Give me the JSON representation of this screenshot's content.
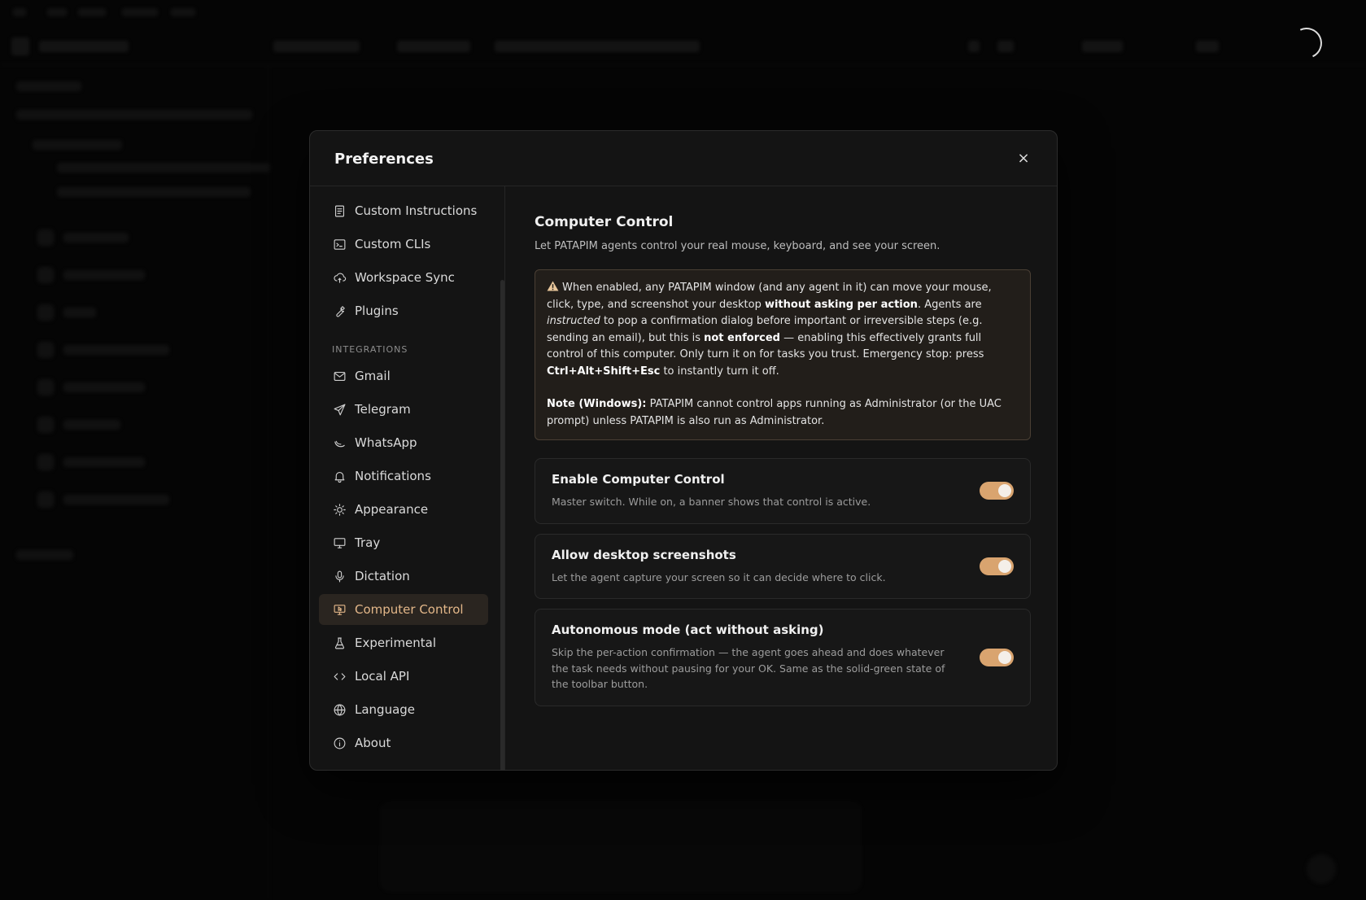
{
  "modal": {
    "title": "Preferences",
    "close_label": "×"
  },
  "nav": {
    "items_top": [
      {
        "label": "Custom Instructions",
        "icon": "document-icon"
      },
      {
        "label": "Custom CLIs",
        "icon": "terminal-icon"
      },
      {
        "label": "Workspace Sync",
        "icon": "cloud-sync-icon"
      },
      {
        "label": "Plugins",
        "icon": "wrench-icon"
      }
    ],
    "section_integrations": "INTEGRATIONS",
    "items_integrations": [
      {
        "label": "Gmail",
        "icon": "mail-icon"
      },
      {
        "label": "Telegram",
        "icon": "send-icon"
      },
      {
        "label": "WhatsApp",
        "icon": "whatsapp-icon"
      },
      {
        "label": "Notifications",
        "icon": "bell-icon"
      },
      {
        "label": "Appearance",
        "icon": "sun-icon"
      },
      {
        "label": "Tray",
        "icon": "monitor-icon"
      },
      {
        "label": "Dictation",
        "icon": "microphone-icon"
      },
      {
        "label": "Computer Control",
        "icon": "cursor-monitor-icon",
        "active": true
      },
      {
        "label": "Experimental",
        "icon": "flask-icon"
      },
      {
        "label": "Local API",
        "icon": "code-icon"
      },
      {
        "label": "Language",
        "icon": "globe-icon"
      },
      {
        "label": "About",
        "icon": "info-icon"
      }
    ]
  },
  "content": {
    "title": "Computer Control",
    "subtitle": "Let PATAPIM agents control your real mouse, keyboard, and see your screen.",
    "warning": {
      "p1_a": "When enabled, any PATAPIM window (and any agent in it) can move your mouse, click, type, and screenshot your desktop ",
      "p1_b": "without asking per action",
      "p1_c": ". Agents are ",
      "p1_d": "instructed",
      "p1_e": " to pop a confirmation dialog before important or irreversible steps (e.g. sending an email), but this is ",
      "p1_f": "not enforced",
      "p1_g": " — enabling this effectively grants full control of this computer. Only turn it on for tasks you trust. Emergency stop: press ",
      "p1_h": "Ctrl+Alt+Shift+Esc",
      "p1_i": " to instantly turn it off.",
      "note_label": "Note (Windows):",
      "note_text": " PATAPIM cannot control apps running as Administrator (or the UAC prompt) unless PATAPIM is also run as Administrator."
    },
    "settings": [
      {
        "title": "Enable Computer Control",
        "desc": "Master switch. While on, a banner shows that control is active.",
        "enabled": true
      },
      {
        "title": "Allow desktop screenshots",
        "desc": "Let the agent capture your screen so it can decide where to click.",
        "enabled": true
      },
      {
        "title": "Autonomous mode (act without asking)",
        "desc": "Skip the per-action confirmation — the agent goes ahead and does whatever the task needs without pausing for your OK. Same as the solid-green state of the toolbar button.",
        "enabled": true
      }
    ]
  },
  "colors": {
    "accent": "#d9a46f",
    "active_text": "#e3b789",
    "warning_border": "#4a3f34",
    "warning_bg": "#221e1a"
  }
}
